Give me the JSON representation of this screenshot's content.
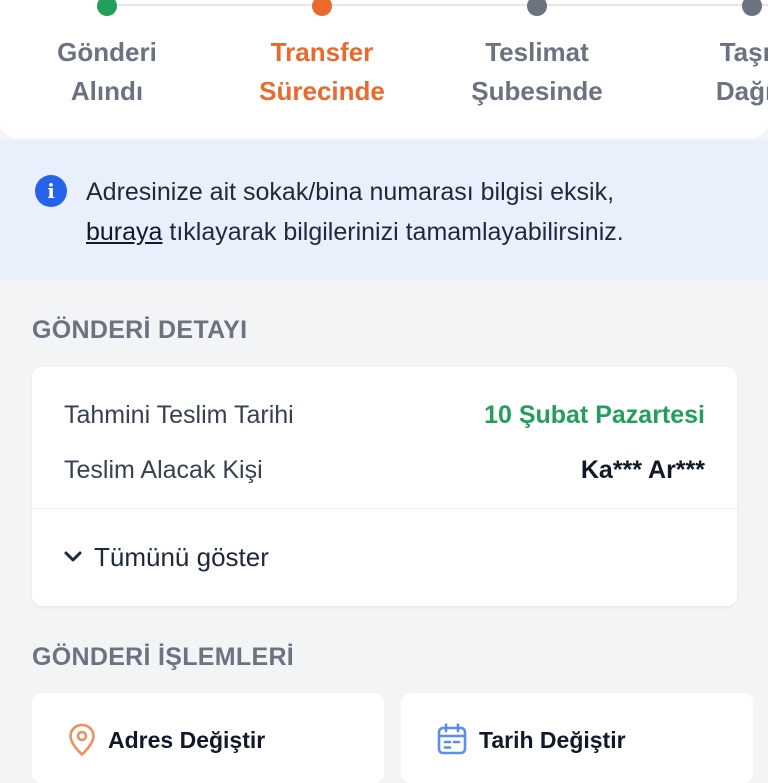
{
  "stepper": {
    "steps": [
      {
        "label_line1": "Gönderi",
        "label_line2": "Alındı",
        "state": "done",
        "color": "#22a05b"
      },
      {
        "label_line1": "Transfer",
        "label_line2": "Sürecinde",
        "state": "active",
        "color": "#ea6a2e"
      },
      {
        "label_line1": "Teslimat",
        "label_line2": "Şubesinde",
        "state": "pending",
        "color": "#6b7280"
      },
      {
        "label_line1": "Taşıy",
        "label_line2": "Dağıtı",
        "state": "pending",
        "color": "#6b7280"
      }
    ]
  },
  "info_banner": {
    "icon": "info-icon",
    "text_part1": "Adresinize ait sokak/bina numarası bilgisi eksik,",
    "link_text": "buraya",
    "text_part2": " tıklayarak bilgilerinizi tamamlayabilirsiniz."
  },
  "details": {
    "section_title": "GÖNDERİ DETAYI",
    "estimated_label": "Tahmini Teslim Tarihi",
    "estimated_value": "10 Şubat Pazartesi",
    "recipient_label": "Teslim Alacak Kişi",
    "recipient_value": "Ka*** Ar***",
    "show_all_label": "Tümünü göster"
  },
  "actions": {
    "section_title": "GÖNDERİ İŞLEMLERİ",
    "items": [
      {
        "label": "Adres Değiştir",
        "icon": "location-pin-icon"
      },
      {
        "label": "Tarih Değiştir",
        "icon": "calendar-icon"
      }
    ]
  },
  "colors": {
    "accent_orange": "#ea6a2e",
    "success_green": "#22a05b",
    "info_blue": "#2563eb",
    "banner_bg": "#e9f0fb"
  }
}
